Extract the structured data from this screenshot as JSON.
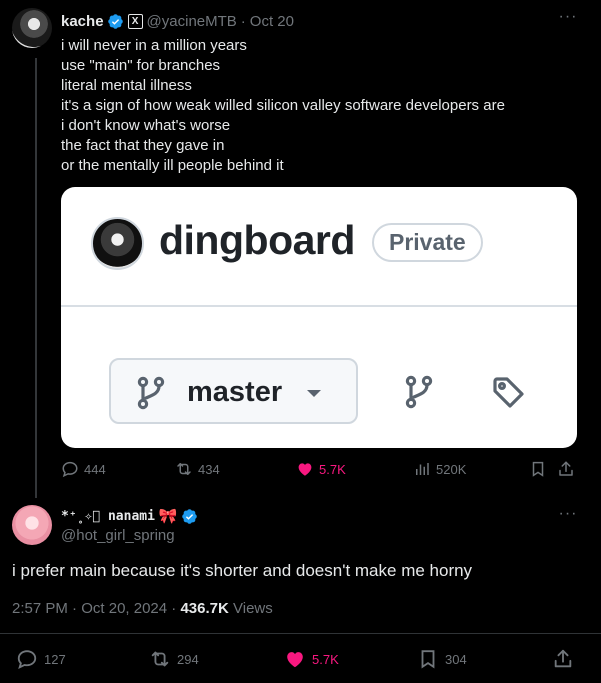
{
  "tweet": {
    "author": {
      "name": "kache",
      "handle": "@yacineMTB",
      "badge": "X"
    },
    "date": "Oct 20",
    "lines": [
      "i will never in a million years",
      "use \"main\" for branches",
      "literal mental illness",
      "it's a sign of how weak willed silicon valley software developers are",
      "i don't know what's worse",
      "the fact that they gave in",
      "or the mentally ill people behind it"
    ],
    "image": {
      "repo_name": "dingboard",
      "visibility": "Private",
      "branch": "master"
    },
    "stats": {
      "replies": "444",
      "reposts": "434",
      "likes": "5.7K",
      "views": "520K"
    }
  },
  "reply": {
    "author": {
      "name": "*⁺˳✧ﾟ nanami",
      "bow": "🎀",
      "handle": "@hot_girl_spring"
    },
    "text": "i prefer main because it's shorter and doesn't make me horny",
    "time": "2:57 PM",
    "date": "Oct 20, 2024",
    "views_count": "436.7K",
    "views_label": "Views",
    "stats": {
      "replies": "127",
      "reposts": "294",
      "likes": "5.7K",
      "bookmarks": "304"
    }
  },
  "colors": {
    "like": "#f91880",
    "verified": "#1d9bf0",
    "muted": "#71767b",
    "background": "#000000"
  }
}
